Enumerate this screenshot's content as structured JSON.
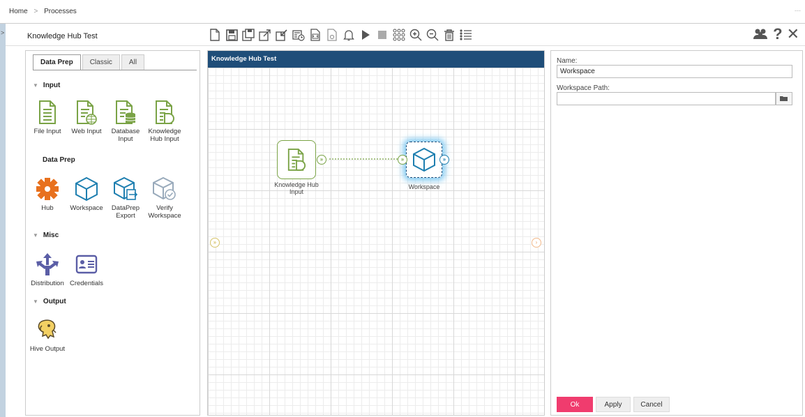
{
  "breadcrumb": {
    "home": "Home",
    "separator": ">",
    "current": "Processes"
  },
  "topbar_dash": "---",
  "leftrail_chevron": ">",
  "process": {
    "title": "Knowledge Hub Test"
  },
  "toolbar": {
    "icons": [
      "new-icon",
      "save-icon",
      "save-as-icon",
      "export-icon",
      "import-icon",
      "schedule-icon",
      "script-icon",
      "settings-doc-icon",
      "alert-bell-icon",
      "run-icon",
      "stop-icon",
      "grid-icon",
      "zoom-in-icon",
      "zoom-out-icon",
      "delete-icon",
      "list-icon"
    ],
    "right_icons": [
      "users-icon",
      "help-icon",
      "close-icon"
    ],
    "help_glyph": "?",
    "close_glyph": "✕"
  },
  "palette": {
    "tabs": [
      {
        "label": "Data Prep",
        "active": true
      },
      {
        "label": "Classic",
        "active": false
      },
      {
        "label": "All",
        "active": false
      }
    ],
    "sections": {
      "input": "Input",
      "data_prep": "Data Prep",
      "misc": "Misc",
      "output": "Output"
    },
    "caret": "▼",
    "input_tools": [
      {
        "label": "File Input",
        "label2": ""
      },
      {
        "label": "Web Input",
        "label2": ""
      },
      {
        "label": "Database",
        "label2": "Input"
      },
      {
        "label": "Knowledge",
        "label2": "Hub Input"
      }
    ],
    "dataprep_tools": [
      {
        "label": "Hub",
        "label2": ""
      },
      {
        "label": "Workspace",
        "label2": ""
      },
      {
        "label": "DataPrep",
        "label2": "Export"
      },
      {
        "label": "Verify",
        "label2": "Workspace"
      }
    ],
    "misc_tools": [
      {
        "label": "Distribution",
        "label2": ""
      },
      {
        "label": "Credentials",
        "label2": ""
      }
    ],
    "output_tools": [
      {
        "label": "Hive Output",
        "label2": ""
      }
    ]
  },
  "canvas": {
    "title": "Knowledge Hub Test",
    "nodes": [
      {
        "label": "Knowledge Hub",
        "label2": "Input"
      },
      {
        "label": "Workspace",
        "label2": ""
      }
    ],
    "port_glyph": "»",
    "end_port_glyph": "›"
  },
  "properties": {
    "name_label": "Name:",
    "name_value": "Workspace",
    "path_label": "Workspace Path:",
    "path_value": "",
    "buttons": {
      "ok": "Ok",
      "apply": "Apply",
      "cancel": "Cancel"
    }
  },
  "colors": {
    "accent_pink": "#f03c6e",
    "header_blue": "#1f4e79",
    "green": "#7aa346",
    "teal_blue": "#1e7fb0",
    "orange": "#e8711e",
    "purple": "#5b5ea6"
  }
}
